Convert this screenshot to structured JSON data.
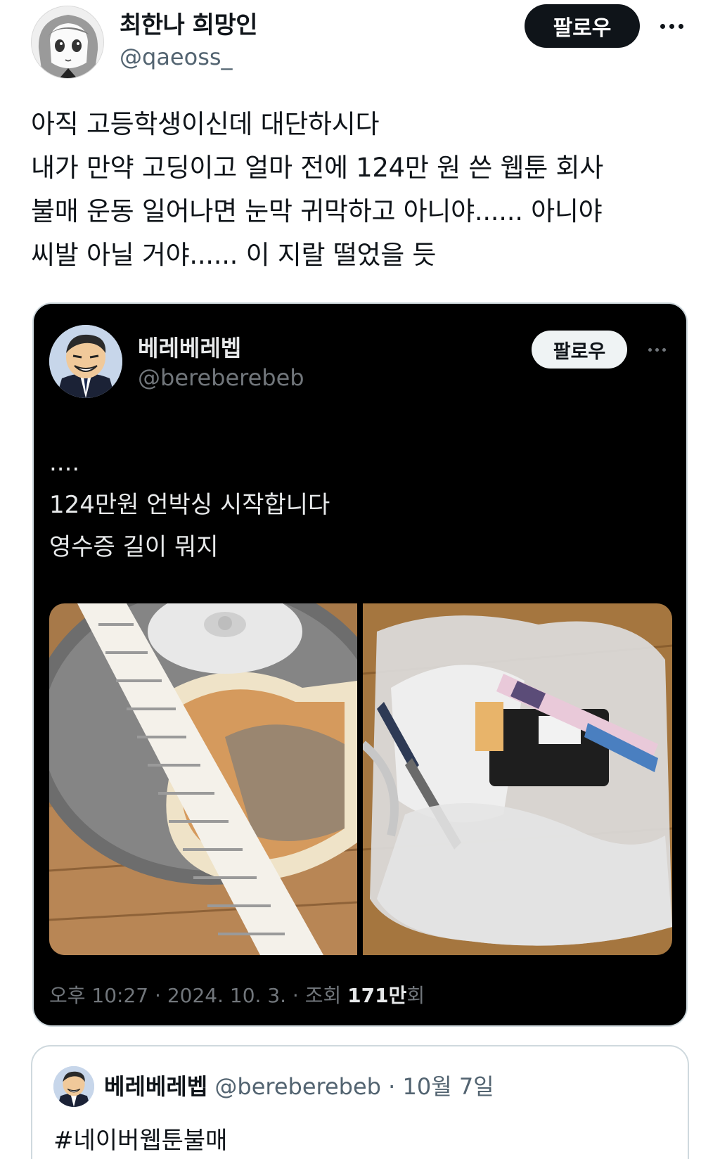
{
  "author": {
    "name": "최한나 희망인",
    "handle": "@qaeoss_"
  },
  "actions": {
    "follow_label": "팔로우",
    "more_icon": "more-horizontal-icon"
  },
  "tweet": {
    "lines": [
      "아직 고등학생이신데 대단하시다",
      "내가 만약 고딩이고 얼마 전에 124만 원 쓴 웹툰 회사",
      "불매 운동 일어나면 눈막 귀막하고 아니야...... 아니야",
      "씨발 아닐 거야...... 이 지랄 떨었을 듯"
    ]
  },
  "embedded": {
    "author": {
      "name": "베레베레벱",
      "handle": "@bereberebeb"
    },
    "follow_label": "팔로우",
    "lines": [
      "....",
      "124만원 언박싱 시작합니다",
      "영수증 길이 뭐지"
    ],
    "meta": {
      "time": "오후 10:27",
      "sep1": " · ",
      "date": "2024. 10. 3.",
      "sep2": " · ",
      "views_prefix": "조회 ",
      "views_number": "171만",
      "views_suffix": "회"
    },
    "photos": [
      "receipt-photo",
      "shopping-bag-photo"
    ]
  },
  "quote": {
    "author": {
      "name": "베레베레벱",
      "handle": "@bereberebeb"
    },
    "sep": " · ",
    "date": "10월 7일",
    "text": "#네이버웹툰불매"
  },
  "colors": {
    "text": "#0f1419",
    "secondary": "#536471",
    "dark_bg": "#000000",
    "dark_text": "#e7e9ea",
    "dark_secondary": "#71767b",
    "border": "#cfd9de"
  }
}
